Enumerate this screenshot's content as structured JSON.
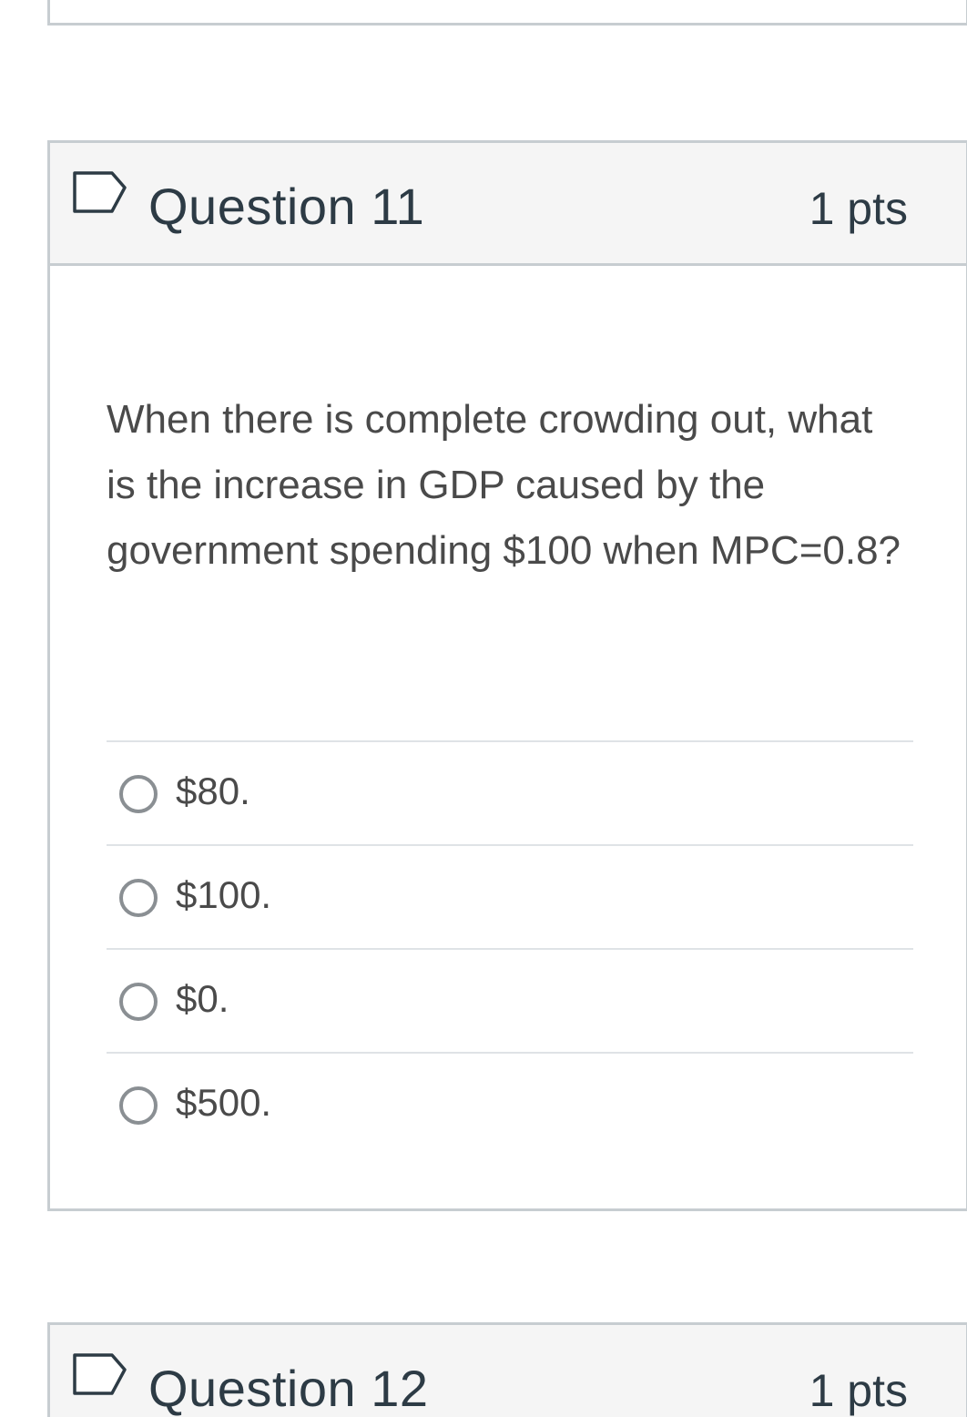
{
  "questions": [
    {
      "title": "Question 11",
      "points": "1 pts",
      "text": "When there is complete crowding out, what is the increase in GDP caused by the government spending $100 when MPC=0.8?",
      "answers": [
        {
          "label": "$80."
        },
        {
          "label": "$100."
        },
        {
          "label": "$0."
        },
        {
          "label": "$500."
        }
      ]
    },
    {
      "title": "Question 12",
      "points": "1 pts"
    }
  ],
  "colors": {
    "header_bg": "#f5f5f5",
    "border": "#c7cdd1",
    "title_text": "#2d3b45",
    "body_text": "#4a4a4a",
    "radio_border": "#8a8f93",
    "flag_stroke": "#2d3b45"
  },
  "icons": {
    "flag": "bookmark-flag-icon",
    "radio": "radio-unselected"
  }
}
